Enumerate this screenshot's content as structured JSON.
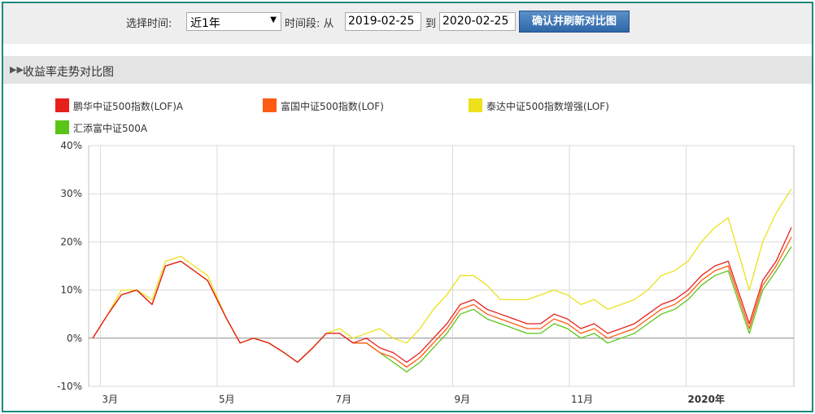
{
  "toolbar": {
    "time_label": "选择时间:",
    "range_selected": "近1年",
    "period_label": "时间段: 从",
    "start_date": "2019-02-25",
    "to_label": "到",
    "end_date": "2020-02-25",
    "submit_label": "确认并刷新对比图"
  },
  "section": {
    "title": "收益率走势对比图"
  },
  "chart_data": {
    "type": "line",
    "title": "",
    "xlabel": "",
    "ylabel": "",
    "ylim": [
      -10,
      40
    ],
    "y_ticks": [
      -10,
      0,
      10,
      20,
      30,
      40
    ],
    "y_tick_labels": [
      "-10%",
      "0%",
      "10%",
      "20%",
      "30%",
      "40%"
    ],
    "x_tick_labels": [
      "3月",
      "5月",
      "7月",
      "9月",
      "11月",
      "2020年"
    ],
    "x_tick_dates": [
      "2019-03-01",
      "2019-05-01",
      "2019-07-01",
      "2019-09-01",
      "2019-11-01",
      "2020-01-01"
    ],
    "grid": true,
    "legend_position": "top",
    "x": [
      "2019-02-25",
      "2019-03-05",
      "2019-03-12",
      "2019-03-20",
      "2019-03-28",
      "2019-04-04",
      "2019-04-12",
      "2019-04-19",
      "2019-04-26",
      "2019-05-06",
      "2019-05-13",
      "2019-05-20",
      "2019-05-28",
      "2019-06-05",
      "2019-06-12",
      "2019-06-20",
      "2019-06-27",
      "2019-07-04",
      "2019-07-11",
      "2019-07-18",
      "2019-07-25",
      "2019-08-01",
      "2019-08-08",
      "2019-08-15",
      "2019-08-22",
      "2019-08-29",
      "2019-09-05",
      "2019-09-12",
      "2019-09-19",
      "2019-09-26",
      "2019-10-10",
      "2019-10-17",
      "2019-10-24",
      "2019-10-31",
      "2019-11-07",
      "2019-11-14",
      "2019-11-21",
      "2019-11-28",
      "2019-12-05",
      "2019-12-12",
      "2019-12-19",
      "2019-12-26",
      "2020-01-02",
      "2020-01-09",
      "2020-01-16",
      "2020-01-23",
      "2020-02-03",
      "2020-02-10",
      "2020-02-17",
      "2020-02-25"
    ],
    "series": [
      {
        "name": "鹏华中证500指数(LOF)A",
        "color": "#e8201c",
        "values": [
          0,
          5,
          9,
          10,
          7,
          15,
          16,
          14,
          12,
          4,
          -1,
          0,
          -1,
          -3,
          -5,
          -2,
          1,
          1,
          -1,
          0,
          -2,
          -3,
          -5,
          -3,
          0,
          3,
          7,
          8,
          6,
          5,
          3,
          3,
          5,
          4,
          2,
          3,
          1,
          2,
          3,
          5,
          7,
          8,
          10,
          13,
          15,
          16,
          3,
          12,
          16,
          23
        ]
      },
      {
        "name": "富国中证500指数(LOF)",
        "color": "#ff5a12",
        "values": [
          0,
          5,
          9,
          10,
          7,
          15,
          16,
          14,
          12,
          4,
          -1,
          0,
          -1,
          -3,
          -5,
          -2,
          1,
          1,
          -1,
          -1,
          -3,
          -4,
          -6,
          -4,
          -1,
          2,
          6,
          7,
          5,
          4,
          2,
          2,
          4,
          3,
          1,
          2,
          0,
          1,
          2,
          4,
          6,
          7,
          9,
          12,
          14,
          15,
          2,
          11,
          15,
          21
        ]
      },
      {
        "name": "泰达中证500指数增强(LOF)",
        "color": "#ede11c",
        "values": [
          0,
          5,
          10,
          10,
          8,
          16,
          17,
          15,
          13,
          4,
          -1,
          0,
          -1,
          -3,
          -5,
          -2,
          1,
          2,
          0,
          1,
          2,
          0,
          -1,
          2,
          6,
          9,
          13,
          13,
          11,
          8,
          8,
          9,
          10,
          9,
          7,
          8,
          6,
          7,
          8,
          10,
          13,
          14,
          16,
          20,
          23,
          25,
          10,
          20,
          26,
          31
        ]
      },
      {
        "name": "汇添富中证500A",
        "color": "#5bc41a",
        "values": [
          0,
          5,
          9,
          10,
          7,
          15,
          16,
          14,
          12,
          4,
          -1,
          0,
          -1,
          -3,
          -5,
          -2,
          1,
          1,
          -1,
          -1,
          -3,
          -5,
          -7,
          -5,
          -2,
          1,
          5,
          6,
          4,
          3,
          1,
          1,
          3,
          2,
          0,
          1,
          -1,
          0,
          1,
          3,
          5,
          6,
          8,
          11,
          13,
          14,
          1,
          10,
          14,
          19
        ]
      }
    ]
  }
}
